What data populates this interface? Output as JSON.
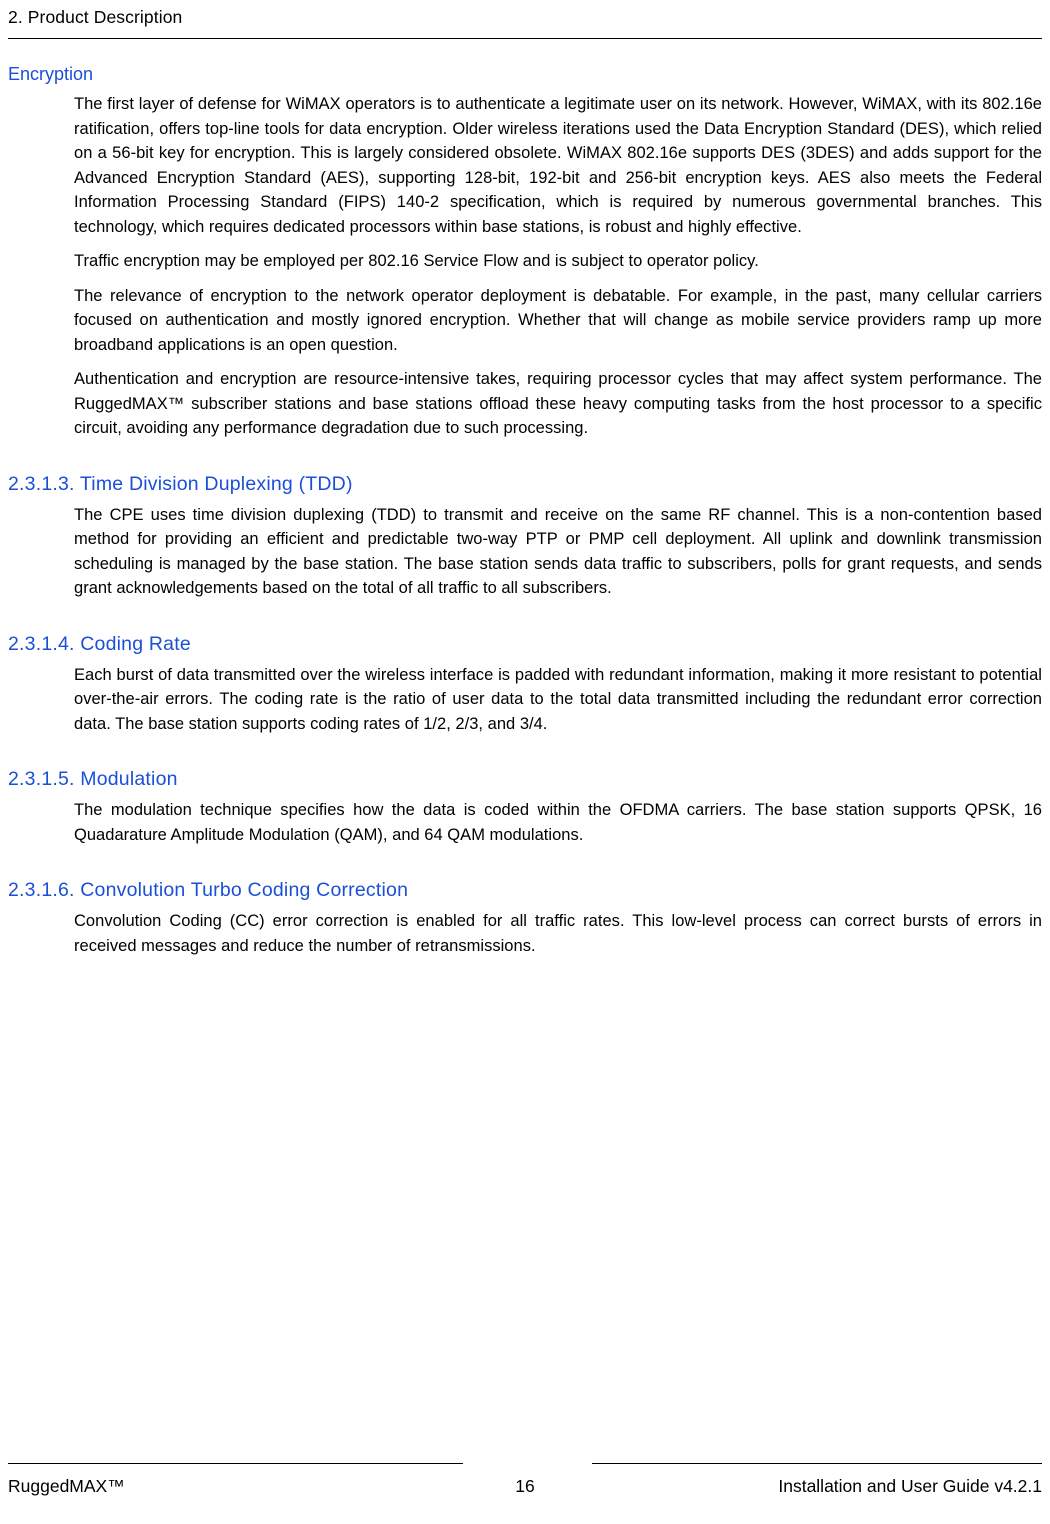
{
  "header": {
    "chapter": "2. Product Description"
  },
  "sections": [
    {
      "id": "encryption",
      "heading": "Encryption",
      "paragraphs": [
        "The first layer of defense for WiMAX operators is to authenticate a legitimate user on its network. However, WiMAX, with its 802.16e ratification, offers top-line tools for data encryption. Older wireless iterations used the Data Encryption Standard (DES), which relied on a 56-bit key for encryption. This is largely considered obsolete. WiMAX 802.16e supports DES (3DES) and adds support for the Advanced Encryption Standard (AES), supporting 128-bit, 192-bit and 256-bit encryption keys. AES also meets the Federal Information Processing Standard (FIPS) 140-2 specification, which is required by numerous governmental branches. This technology, which requires dedicated processors within base stations, is robust and highly effective.",
        "Traffic encryption may be employed per 802.16 Service Flow and is subject to operator policy.",
        "The relevance of encryption to the network operator deployment is debatable. For example, in the past, many cellular carriers focused on authentication and mostly ignored encryption. Whether that will change as mobile service providers ramp up more broadband applications is an open question.",
        "Authentication and encryption are resource-intensive takes, requiring processor cycles that may affect system performance. The RuggedMAX™ subscriber stations and base stations offload these heavy computing tasks from the host processor to a specific circuit, avoiding any performance degradation due to such processing."
      ]
    },
    {
      "id": "tdd",
      "heading": "2.3.1.3. Time Division Duplexing (TDD)",
      "paragraphs": [
        "The CPE uses time division duplexing (TDD) to transmit and receive on the same RF channel. This is a non-contention based method for providing an efficient and predictable two-way PTP or PMP cell deployment. All uplink and downlink transmission scheduling is managed by the base station. The base station sends data traffic to subscribers, polls for grant requests, and sends grant acknowledgements based on the total of all traffic to all subscribers."
      ]
    },
    {
      "id": "coding-rate",
      "heading": "2.3.1.4. Coding Rate",
      "paragraphs": [
        "Each burst of data transmitted over the wireless interface is padded with redundant information, making it more resistant to potential over-the-air errors. The coding rate is the ratio of user data to the total data transmitted including the redundant error correction data. The base station supports coding rates of 1/2, 2/3, and 3/4."
      ]
    },
    {
      "id": "modulation",
      "heading": "2.3.1.5. Modulation",
      "paragraphs": [
        "The modulation technique specifies how the data is coded within the OFDMA carriers. The base station supports QPSK, 16 Quadarature Amplitude Modulation (QAM), and 64 QAM modulations."
      ]
    },
    {
      "id": "convolution",
      "heading": "2.3.1.6. Convolution Turbo Coding Correction",
      "paragraphs": [
        "Convolution Coding (CC) error correction is enabled for all traffic rates. This low-level process can correct bursts of errors in received messages and reduce the number of retransmissions."
      ]
    }
  ],
  "footer": {
    "left": "RuggedMAX™",
    "page_number": "16",
    "right": "Installation and User Guide v4.2.1"
  },
  "colors": {
    "heading_blue": "#1b4fd8",
    "text_black": "#000000",
    "background": "#ffffff"
  }
}
